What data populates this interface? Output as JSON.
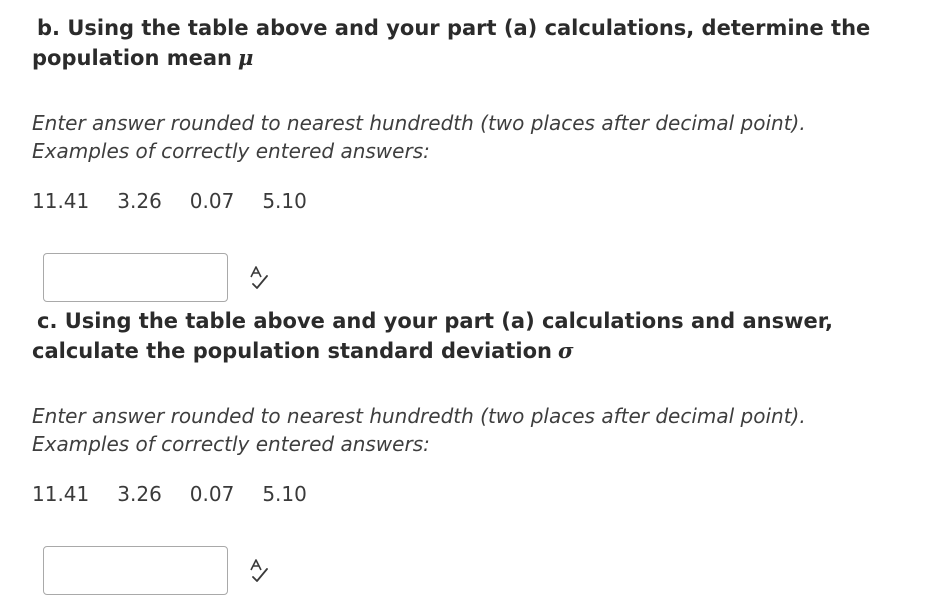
{
  "part_b": {
    "letter": "b.",
    "heading": "Using the table above and your part (a) calculations, determine the population mean",
    "symbol": "μ",
    "instruction_line1": "Enter answer rounded to nearest hundredth (two places after decimal point).",
    "instruction_line2": "Examples of correctly entered answers:",
    "examples": [
      "11.41",
      "3.26",
      "0.07",
      "5.10"
    ],
    "answer_value": "",
    "icon": "spellcheck-icon"
  },
  "part_c": {
    "letter": "c.",
    "heading": "Using the table above and your part (a) calculations and answer, calculate the population standard deviation",
    "symbol": "σ",
    "instruction_line1": "Enter answer rounded to nearest hundredth (two places after decimal point).",
    "instruction_line2": "Examples of correctly entered answers:",
    "examples": [
      "11.41",
      "3.26",
      "0.07",
      "5.10"
    ],
    "answer_value": "",
    "icon": "spellcheck-icon"
  }
}
